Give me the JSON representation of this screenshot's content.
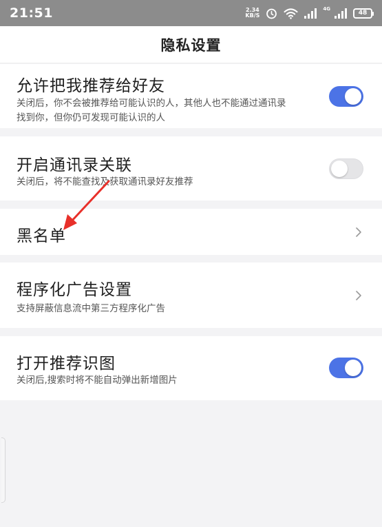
{
  "status_bar": {
    "time": "21:51",
    "speed_value": "2.34",
    "speed_unit": "KB/S",
    "network_label": "4G",
    "battery": "48"
  },
  "header": {
    "title": "隐私设置"
  },
  "settings": {
    "recommend_to_friends": {
      "title": "允许把我推荐给好友",
      "subtitle": "关闭后，你不会被推荐给可能认识的人，其他人也不能通过通讯录找到你，但你仍可发现可能认识的人",
      "enabled": true
    },
    "contacts_link": {
      "title": "开启通讯录关联",
      "subtitle": "关闭后，将不能查找及获取通讯录好友推荐",
      "enabled": false
    },
    "blacklist": {
      "title": "黑名单"
    },
    "programmatic_ads": {
      "title": "程序化广告设置",
      "subtitle": "支持屏蔽信息流中第三方程序化广告"
    },
    "recommend_image": {
      "title": "打开推荐识图",
      "subtitle": "关闭后,搜索时将不能自动弹出新增图片",
      "enabled": true
    }
  },
  "colors": {
    "accent": "#4c73e6",
    "annotation_arrow": "#e8302a",
    "status_bar": "#8c8c8c",
    "background": "#f3f3f5"
  }
}
